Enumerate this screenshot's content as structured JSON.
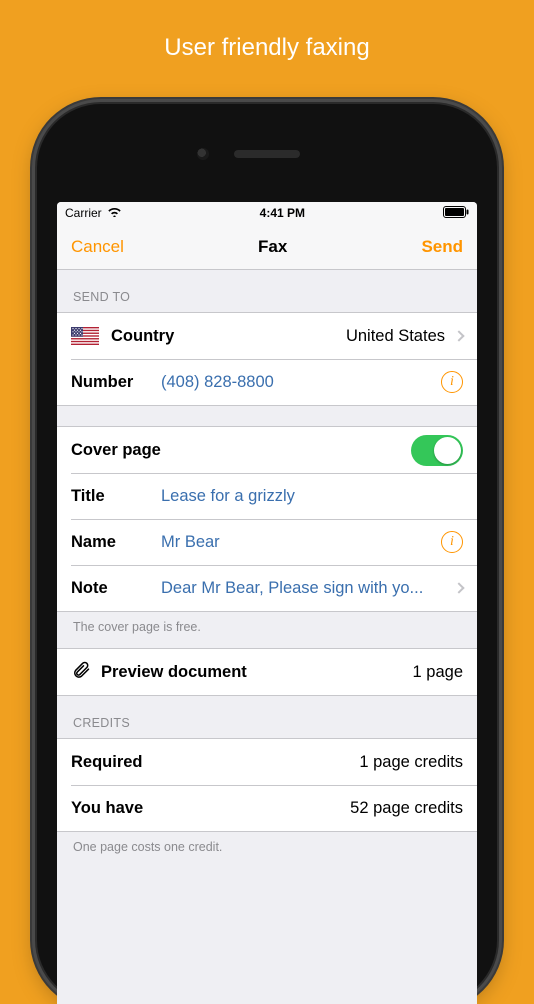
{
  "promo": {
    "title": "User friendly faxing"
  },
  "status": {
    "carrier": "Carrier",
    "time": "4:41 PM"
  },
  "nav": {
    "cancel": "Cancel",
    "title": "Fax",
    "send": "Send"
  },
  "send_to": {
    "header": "SEND TO",
    "country_label": "Country",
    "country_value": "United States",
    "number_label": "Number",
    "number_value": "(408) 828-8800"
  },
  "cover": {
    "label": "Cover page",
    "toggle_on": true,
    "title_label": "Title",
    "title_value": "Lease for a grizzly",
    "name_label": "Name",
    "name_value": "Mr Bear",
    "note_label": "Note",
    "note_value": "Dear Mr Bear, Please sign with yo...",
    "footer": "The cover page is free."
  },
  "preview": {
    "label": "Preview document",
    "pages": "1 page"
  },
  "credits": {
    "header": "CREDITS",
    "required_label": "Required",
    "required_value": "1 page credits",
    "have_label": "You have",
    "have_value": "52 page credits",
    "footer": "One page costs one credit."
  },
  "colors": {
    "accent": "#ff9500",
    "toggle_on": "#34c759",
    "link": "#3a6fae"
  }
}
